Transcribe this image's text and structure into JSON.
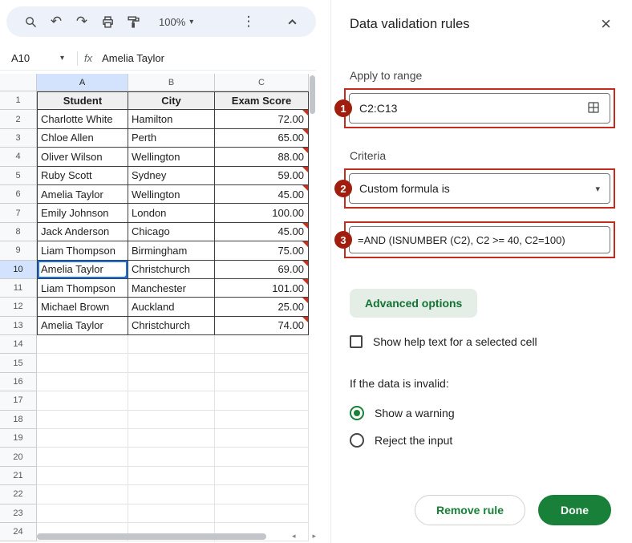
{
  "toolbar": {
    "zoom_label": "100%",
    "icons": {
      "undo": "↶",
      "redo": "↷",
      "more_vertical": "⋮",
      "dropdown_caret": "▾",
      "close": "×",
      "scroll_left": "◂",
      "scroll_right": "▸"
    }
  },
  "formula_bar": {
    "name_box": "A10",
    "fx_label": "fx",
    "value": "Amelia Taylor"
  },
  "grid": {
    "column_headers": [
      "A",
      "B",
      "C"
    ],
    "table_header": [
      "Student",
      "City",
      "Exam Score"
    ],
    "rows": [
      {
        "student": "Charlotte White",
        "city": "Hamilton",
        "score": "72.00",
        "invalid": true
      },
      {
        "student": "Chloe Allen",
        "city": "Perth",
        "score": "65.00",
        "invalid": true
      },
      {
        "student": "Oliver Wilson",
        "city": "Wellington",
        "score": "88.00",
        "invalid": true
      },
      {
        "student": "Ruby Scott",
        "city": "Sydney",
        "score": "59.00",
        "invalid": true
      },
      {
        "student": "Amelia Taylor",
        "city": "Wellington",
        "score": "45.00",
        "invalid": true
      },
      {
        "student": "Emily Johnson",
        "city": "London",
        "score": "100.00",
        "invalid": false
      },
      {
        "student": "Jack Anderson",
        "city": "Chicago",
        "score": "45.00",
        "invalid": true
      },
      {
        "student": "Liam Thompson",
        "city": "Birmingham",
        "score": "75.00",
        "invalid": true
      },
      {
        "student": "Amelia Taylor",
        "city": "Christchurch",
        "score": "69.00",
        "invalid": true
      },
      {
        "student": "Liam Thompson",
        "city": "Manchester",
        "score": "101.00",
        "invalid": true
      },
      {
        "student": "Michael Brown",
        "city": "Auckland",
        "score": "25.00",
        "invalid": true
      },
      {
        "student": "Amelia Taylor",
        "city": "Christchurch",
        "score": "74.00",
        "invalid": true
      }
    ],
    "first_data_row": 2,
    "total_rows": 24,
    "selected_cell": "A10",
    "selected_row": 10,
    "selected_col": "A"
  },
  "panel": {
    "title": "Data validation rules",
    "apply_to_range": {
      "label": "Apply to range",
      "value": "C2:C13",
      "badge": "1"
    },
    "criteria": {
      "label": "Criteria",
      "value": "Custom formula is",
      "badge": "2"
    },
    "formula": {
      "value": "=AND (ISNUMBER (C2), C2 >= 40, C2=100)",
      "badge": "3"
    },
    "advanced_options_label": "Advanced options",
    "help_checkbox_label": "Show help text for a selected cell",
    "invalid_section_label": "If the data is invalid:",
    "options": [
      {
        "label": "Show a warning",
        "selected": true
      },
      {
        "label": "Reject the input",
        "selected": false
      }
    ],
    "remove_rule_label": "Remove rule",
    "done_label": "Done"
  },
  "colors": {
    "accent_green": "#188038",
    "advanced_button_bg": "#e4ede6",
    "annotation_red": "#c42b1c",
    "badge_red": "#a11e0f",
    "selection_blue": "#1a73e8",
    "invalid_flag_red": "#c5321f",
    "header_highlight_blue": "#d3e3fd",
    "toolbar_bg": "#edf2fa"
  }
}
